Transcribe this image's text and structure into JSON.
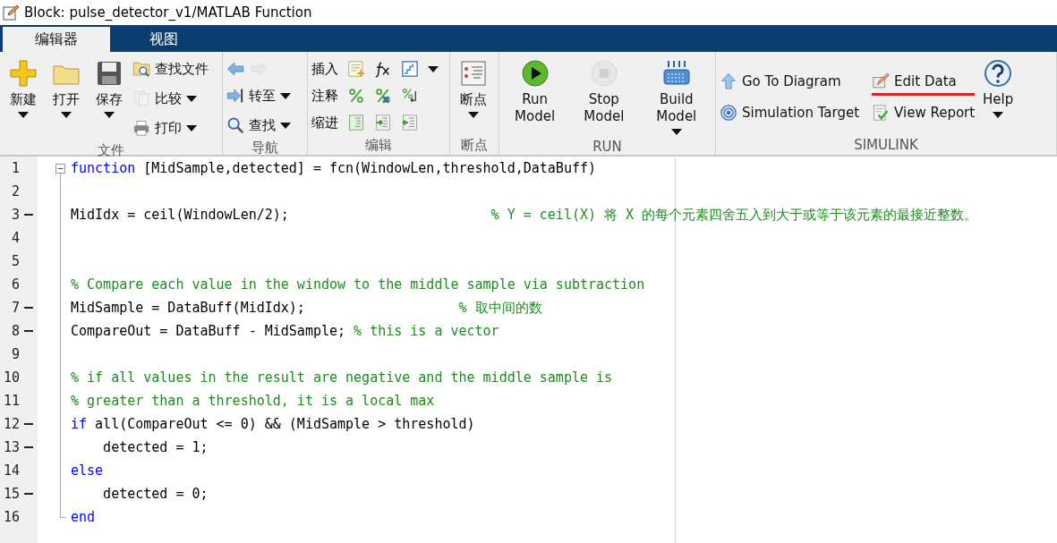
{
  "window": {
    "title": "Block: pulse_detector_v1/MATLAB Function"
  },
  "tabs": [
    {
      "label": "编辑器",
      "selected": true
    },
    {
      "label": "视图",
      "selected": false
    }
  ],
  "ribbon": {
    "groups": [
      {
        "title": "文件",
        "items": [
          {
            "kind": "large",
            "label": "新建",
            "dropdown": true,
            "disabled": false
          },
          {
            "kind": "large",
            "label": "打开",
            "dropdown": true,
            "disabled": false
          },
          {
            "kind": "large",
            "label": "保存",
            "dropdown": true,
            "disabled": false
          },
          {
            "kind": "small",
            "label": "查找文件",
            "dropdown": false,
            "disabled": false
          },
          {
            "kind": "small",
            "label": "比较",
            "dropdown": true,
            "disabled": true
          },
          {
            "kind": "small",
            "label": "打印",
            "dropdown": true,
            "disabled": false
          }
        ]
      },
      {
        "title": "导航",
        "items": [
          {
            "kind": "icon",
            "disabled": false
          },
          {
            "kind": "icon",
            "disabled": true
          },
          {
            "kind": "small",
            "label": "转至",
            "dropdown": true,
            "disabled": false
          },
          {
            "kind": "small",
            "label": "查找",
            "dropdown": true,
            "disabled": false
          }
        ]
      },
      {
        "title": "编辑",
        "items": [
          {
            "kind": "row",
            "label": "插入",
            "dropdown": true,
            "disabled": false
          },
          {
            "kind": "row",
            "label": "注释",
            "dropdown": false,
            "disabled": false
          },
          {
            "kind": "row",
            "label": "缩进",
            "dropdown": false,
            "disabled": false
          }
        ]
      },
      {
        "title": "断点",
        "items": [
          {
            "kind": "large",
            "label": "断点",
            "dropdown": true,
            "disabled": false
          }
        ]
      },
      {
        "title": "RUN",
        "items": [
          {
            "kind": "large",
            "label": "Run Model",
            "dropdown": false,
            "disabled": false
          },
          {
            "kind": "large",
            "label": "Stop Model",
            "dropdown": false,
            "disabled": true
          },
          {
            "kind": "large",
            "label": "Build Model",
            "dropdown": true,
            "disabled": false
          }
        ]
      },
      {
        "title": "SIMULINK",
        "items": [
          {
            "kind": "small",
            "label": "Go To Diagram",
            "dropdown": false,
            "disabled": false,
            "underlined": false
          },
          {
            "kind": "small",
            "label": "Edit Data",
            "dropdown": false,
            "disabled": false,
            "underlined": true
          },
          {
            "kind": "small",
            "label": "Simulation Target",
            "dropdown": false,
            "disabled": false,
            "underlined": false
          },
          {
            "kind": "small",
            "label": "View Report",
            "dropdown": false,
            "disabled": false,
            "underlined": false
          },
          {
            "kind": "large",
            "label": "Help",
            "dropdown": true,
            "disabled": false
          }
        ]
      }
    ]
  },
  "editor": {
    "lines": [
      {
        "number": "1",
        "executable": false,
        "collapsible": true,
        "block_end": false,
        "segments": [
          {
            "kind": "keyword",
            "text": "function"
          },
          {
            "kind": "code",
            "text": " [MidSample,detected] = fcn(WindowLen,threshold,DataBuff)"
          }
        ]
      },
      {
        "number": "2",
        "executable": false,
        "collapsible": false,
        "block_end": false
      },
      {
        "number": "3",
        "executable": true,
        "collapsible": false,
        "block_end": false,
        "segments": [
          {
            "kind": "code",
            "text": "MidIdx = ceil(WindowLen/2);                         "
          },
          {
            "kind": "comment",
            "text": "% Y = ceil(X) 将 X 的每个元素四舍五入到大于或等于该元素的最接近整数。"
          }
        ]
      },
      {
        "number": "4",
        "executable": false,
        "collapsible": false,
        "block_end": false
      },
      {
        "number": "5",
        "executable": false,
        "collapsible": false,
        "block_end": false
      },
      {
        "number": "6",
        "executable": false,
        "collapsible": false,
        "block_end": false,
        "segments": [
          {
            "kind": "comment",
            "text": "% Compare each value in the window to the middle sample via subtraction"
          }
        ]
      },
      {
        "number": "7",
        "executable": true,
        "collapsible": false,
        "block_end": false,
        "segments": [
          {
            "kind": "code",
            "text": "MidSample = DataBuff(MidIdx);                   "
          },
          {
            "kind": "comment",
            "text": "% 取中间的数"
          }
        ]
      },
      {
        "number": "8",
        "executable": true,
        "collapsible": false,
        "block_end": false,
        "segments": [
          {
            "kind": "code",
            "text": "CompareOut = DataBuff - MidSample; "
          },
          {
            "kind": "comment",
            "text": "% this is a vector"
          }
        ]
      },
      {
        "number": "9",
        "executable": false,
        "collapsible": false,
        "block_end": false
      },
      {
        "number": "10",
        "executable": false,
        "collapsible": false,
        "block_end": false,
        "segments": [
          {
            "kind": "comment",
            "text": "% if all values in the result are negative and the middle sample is"
          }
        ]
      },
      {
        "number": "11",
        "executable": false,
        "collapsible": false,
        "block_end": false,
        "segments": [
          {
            "kind": "comment",
            "text": "% greater than a threshold, it is a local max"
          }
        ]
      },
      {
        "number": "12",
        "executable": true,
        "collapsible": false,
        "block_end": false,
        "segments": [
          {
            "kind": "keyword",
            "text": "if"
          },
          {
            "kind": "code",
            "text": " all(CompareOut <= 0) && (MidSample > threshold)"
          }
        ]
      },
      {
        "number": "13",
        "executable": true,
        "collapsible": false,
        "block_end": false,
        "segments": [
          {
            "kind": "code",
            "text": "    detected = 1;"
          }
        ]
      },
      {
        "number": "14",
        "executable": false,
        "collapsible": false,
        "block_end": false,
        "segments": [
          {
            "kind": "keyword",
            "text": "else"
          }
        ]
      },
      {
        "number": "15",
        "executable": true,
        "collapsible": false,
        "block_end": false,
        "segments": [
          {
            "kind": "code",
            "text": "    detected = 0;"
          }
        ]
      },
      {
        "number": "16",
        "executable": false,
        "collapsible": false,
        "block_end": true,
        "segments": [
          {
            "kind": "keyword",
            "text": "end"
          }
        ]
      }
    ]
  }
}
